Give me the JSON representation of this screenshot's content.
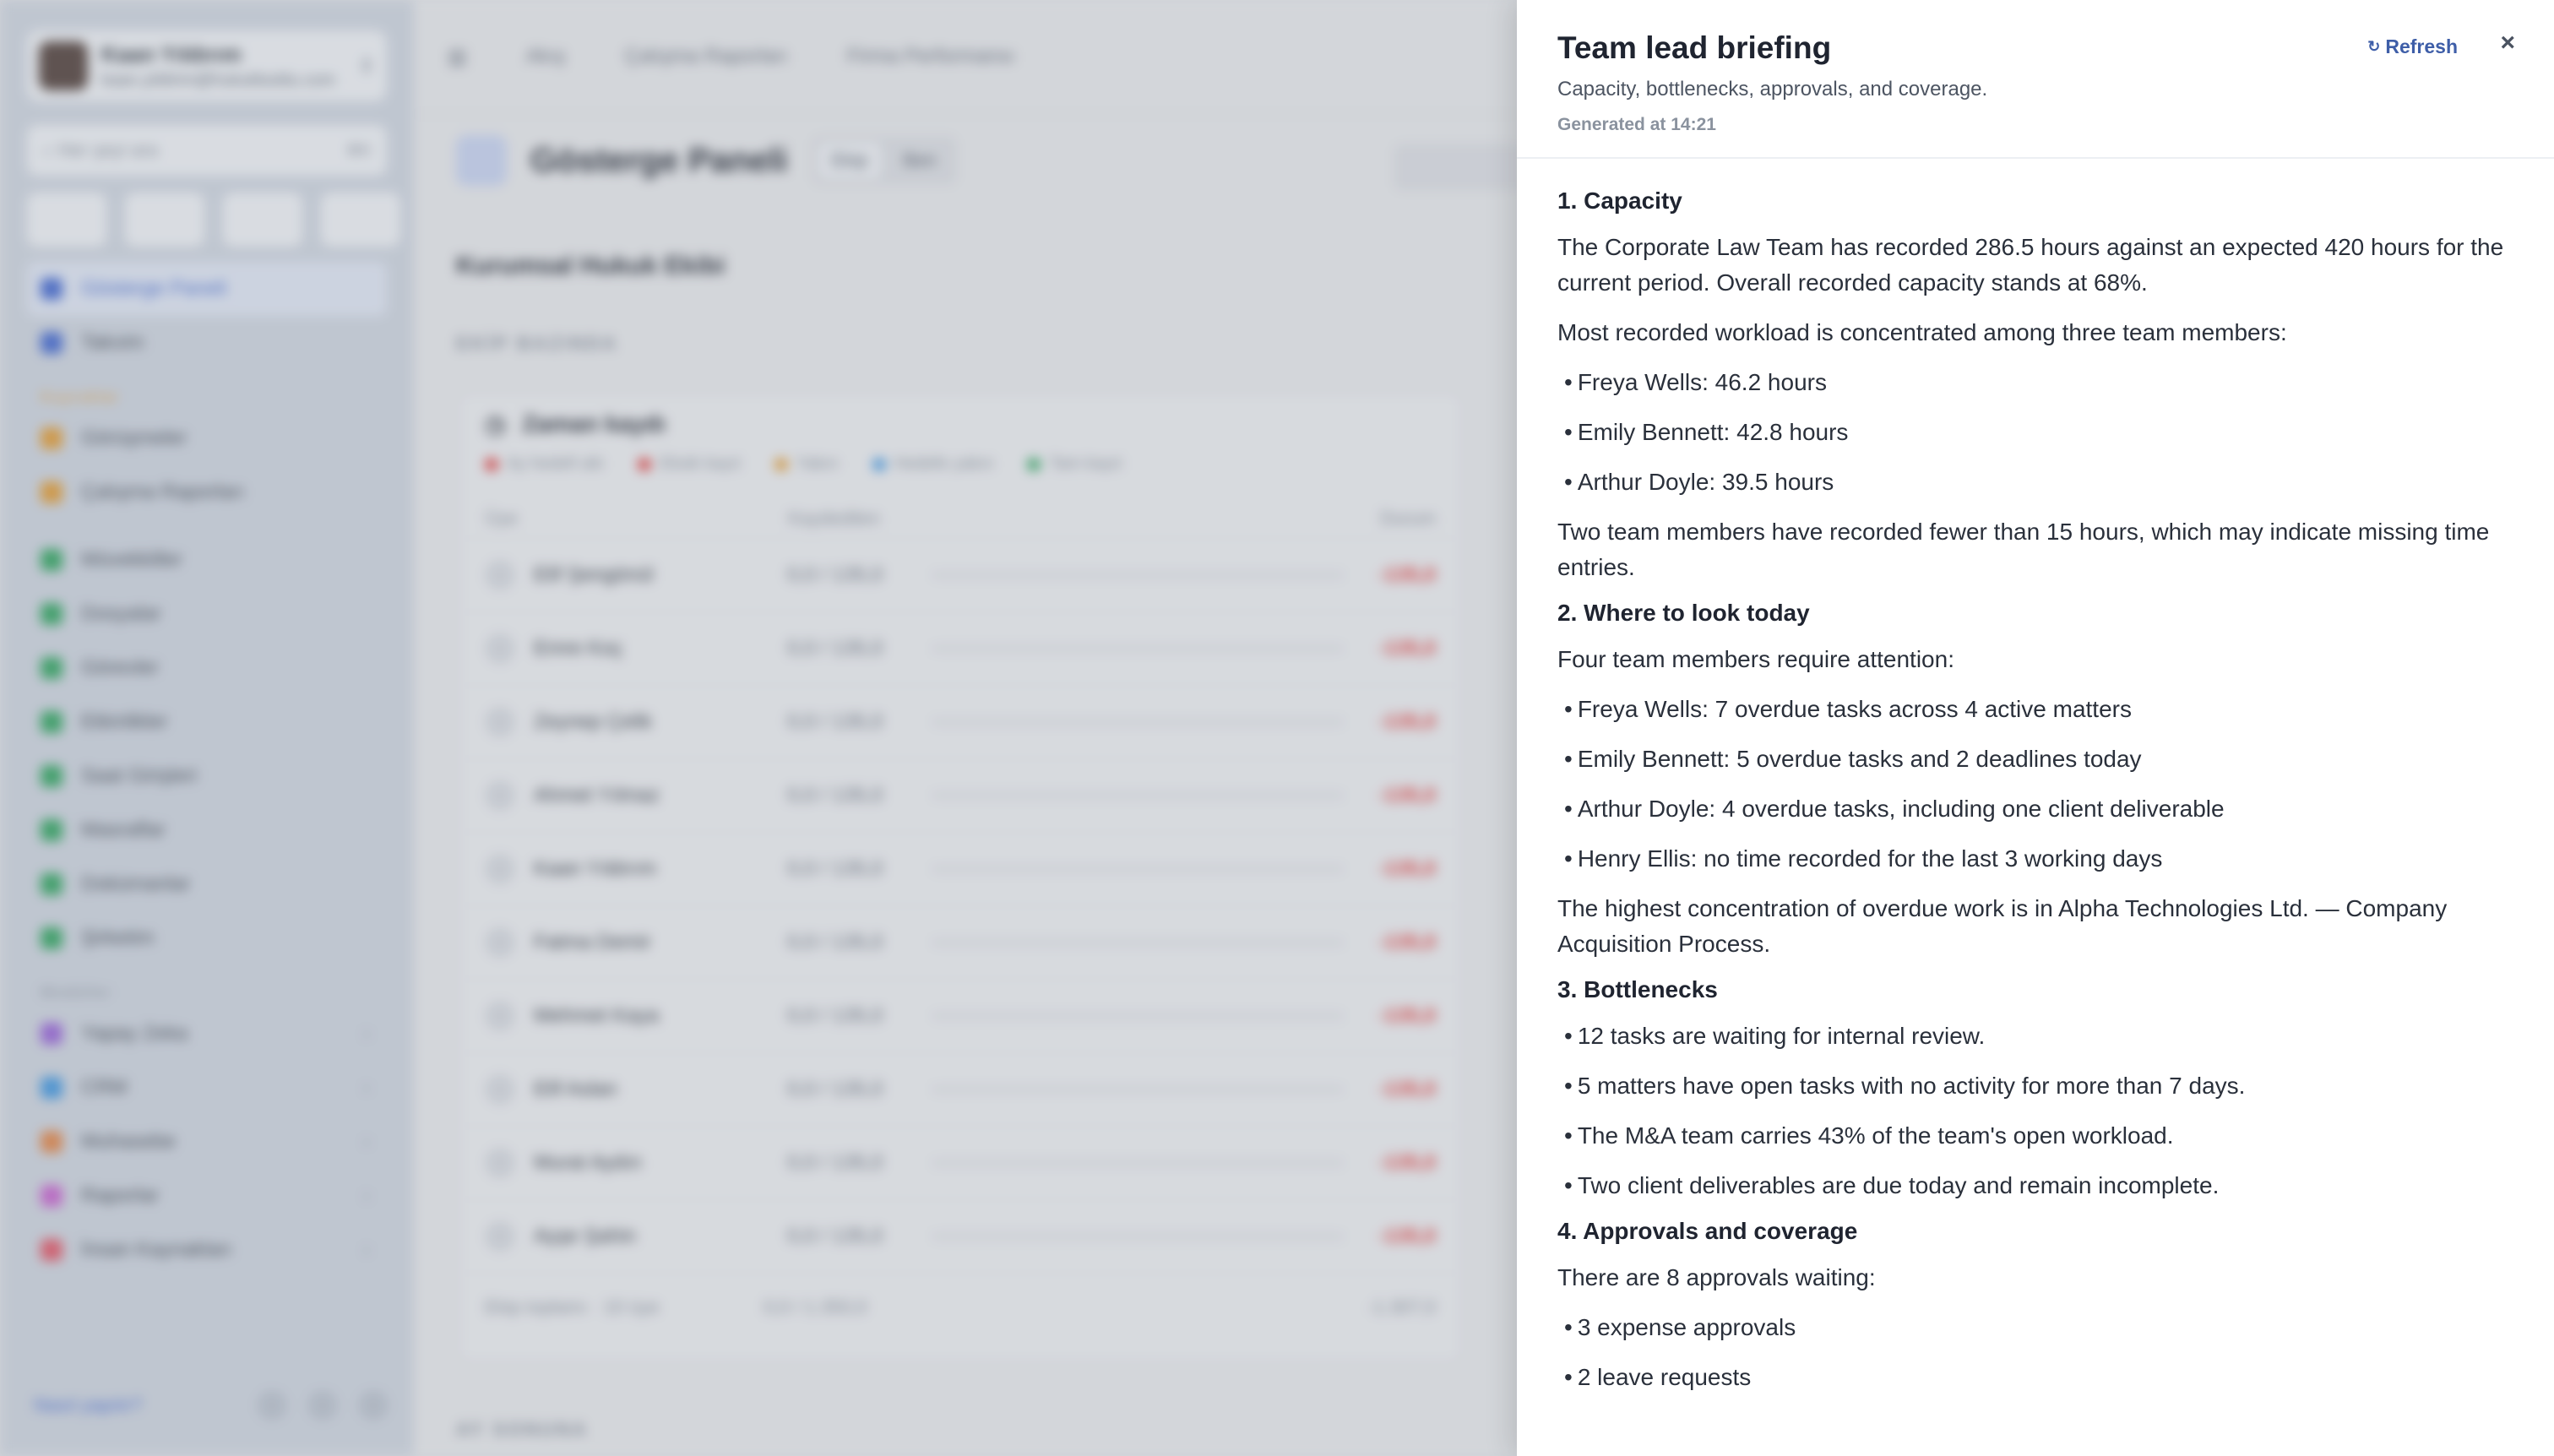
{
  "background": {
    "user": {
      "name": "Kaan Yıldırım",
      "email": "kaan.yildirim@hukukbuldu.com"
    },
    "search": {
      "placeholder": "Her şeyi ara",
      "shortcut": "⌘K"
    },
    "nav": [
      {
        "label": "Gösterge Paneli",
        "color": "#4b6fd1",
        "active": true
      },
      {
        "label": "Takvim",
        "color": "#4b6fd1"
      }
    ],
    "nav_section_workflow": "Kuyruklar",
    "nav_workflow": [
      {
        "label": "Görüşmeler",
        "color": "#e0a040"
      },
      {
        "label": "Çalışma Raporları",
        "color": "#e0a040"
      }
    ],
    "nav_records": [
      {
        "label": "Müvekkiller",
        "color": "#3aa868"
      },
      {
        "label": "Dosyalar",
        "color": "#3aa868"
      },
      {
        "label": "Görevler",
        "color": "#3aa868"
      },
      {
        "label": "Etkinlikler",
        "color": "#3aa868"
      },
      {
        "label": "Saat Girişleri",
        "color": "#3aa868"
      },
      {
        "label": "Masraflar",
        "color": "#3aa868"
      },
      {
        "label": "Dokümanlar",
        "color": "#3aa868"
      },
      {
        "label": "Şirketim",
        "color": "#3aa868"
      }
    ],
    "nav_section_modules": "Modüller",
    "nav_modules": [
      {
        "label": "Yapay Zeka",
        "color": "#9b6ad8"
      },
      {
        "label": "CRM",
        "color": "#4a9be0"
      },
      {
        "label": "Muhasebe",
        "color": "#e08a50"
      },
      {
        "label": "Raporlar",
        "color": "#c86ad0"
      },
      {
        "label": "İnsan Kaynakları",
        "color": "#e06070"
      }
    ],
    "footer_link": "Nasıl yapılır?",
    "tabs": [
      "Akış",
      "Çalışma Raporları",
      "Firma Performansı"
    ],
    "page_title": "Gösterge Paneli",
    "segments": [
      "Ekip",
      "Ben"
    ],
    "team_title": "Kurumsal Hukuk Ekibi",
    "section_kicker": "EKİP BAZINDA",
    "card_title": "Zaman kaydı",
    "legend": [
      {
        "label": "Ay hedefi altı",
        "color": "#e04848"
      },
      {
        "label": "Eksik kayıt",
        "color": "#e04848"
      },
      {
        "label": "Yakın",
        "color": "#e0a040"
      },
      {
        "label": "Hedefe yakın",
        "color": "#4a9be0"
      },
      {
        "label": "Tam kayıt",
        "color": "#3aa868"
      }
    ],
    "table_headers": [
      "Üye",
      "Kaydedilen",
      "Durum"
    ],
    "rows": [
      {
        "idx": "01",
        "name": "Elif Şengönül",
        "hours": "0,0 / 135,0",
        "value": "-135,0"
      },
      {
        "idx": "02",
        "name": "Emre Koç",
        "hours": "0,0 / 135,0",
        "value": "-135,0"
      },
      {
        "idx": "03",
        "name": "Zeynep Çelik",
        "hours": "0,0 / 135,0",
        "value": "-135,0"
      },
      {
        "idx": "04",
        "name": "Ahmet Yılmaz",
        "hours": "0,0 / 135,0",
        "value": "-135,0"
      },
      {
        "idx": "05",
        "name": "Kaan Yıldırım",
        "hours": "0,0 / 135,0",
        "value": "-135,0"
      },
      {
        "idx": "06",
        "name": "Fatma Demir",
        "hours": "0,0 / 135,0",
        "value": "-135,0"
      },
      {
        "idx": "07",
        "name": "Mehmet Kaya",
        "hours": "0,0 / 135,0",
        "value": "-135,0"
      },
      {
        "idx": "08",
        "name": "Elif Aslan",
        "hours": "0,0 / 135,0",
        "value": "-135,0"
      },
      {
        "idx": "09",
        "name": "Murat Aydın",
        "hours": "0,0 / 135,0",
        "value": "-135,0"
      },
      {
        "idx": "10",
        "name": "Ayşe Şahin",
        "hours": "0,0 / 135,0",
        "value": "-135,0"
      }
    ],
    "card_footer": {
      "label": "Ekip toplamı · 10 üye",
      "hours": "0,0 / 1.350,0",
      "value": "-1.307,0"
    },
    "bottom_kicker": "AY SONUNA"
  },
  "drawer": {
    "title": "Team lead briefing",
    "subtitle": "Capacity, bottlenecks, approvals, and coverage.",
    "generated": "Generated at 14:21",
    "refresh_icon": "↻",
    "refresh_label": "Refresh",
    "close_icon": "×",
    "sections": [
      {
        "title": "1. Capacity",
        "blocks": [
          {
            "type": "p",
            "text": "The Corporate Law Team has recorded 286.5 hours against an expected 420 hours for the current period. Overall recorded capacity stands at 68%."
          },
          {
            "type": "p",
            "text": "Most recorded workload is concentrated among three team members:"
          },
          {
            "type": "li",
            "text": "Freya Wells: 46.2 hours"
          },
          {
            "type": "li",
            "text": "Emily Bennett: 42.8 hours"
          },
          {
            "type": "li",
            "text": "Arthur Doyle: 39.5 hours"
          },
          {
            "type": "p",
            "text": "Two team members have recorded fewer than 15 hours, which may indicate missing time entries."
          }
        ]
      },
      {
        "title": "2. Where to look today",
        "blocks": [
          {
            "type": "p",
            "text": "Four team members require attention:"
          },
          {
            "type": "li",
            "text": "Freya Wells: 7 overdue tasks across 4 active matters"
          },
          {
            "type": "li",
            "text": "Emily Bennett: 5 overdue tasks and 2 deadlines today"
          },
          {
            "type": "li",
            "text": "Arthur Doyle: 4 overdue tasks, including one client deliverable"
          },
          {
            "type": "li",
            "text": "Henry Ellis: no time recorded for the last 3 working days"
          },
          {
            "type": "p",
            "text": "The highest concentration of overdue work is in Alpha Technologies Ltd. — Company Acquisition Process."
          }
        ]
      },
      {
        "title": "3. Bottlenecks",
        "blocks": [
          {
            "type": "li",
            "text": "12 tasks are waiting for internal review."
          },
          {
            "type": "li",
            "text": "5 matters have open tasks with no activity for more than 7 days."
          },
          {
            "type": "li",
            "text": "The M&A team carries 43% of the team's open workload."
          },
          {
            "type": "li",
            "text": "Two client deliverables are due today and remain incomplete."
          }
        ]
      },
      {
        "title": "4. Approvals and coverage",
        "blocks": [
          {
            "type": "p",
            "text": "There are 8 approvals waiting:"
          },
          {
            "type": "li",
            "text": "3 expense approvals"
          },
          {
            "type": "li",
            "text": "2 leave requests"
          }
        ]
      }
    ]
  }
}
